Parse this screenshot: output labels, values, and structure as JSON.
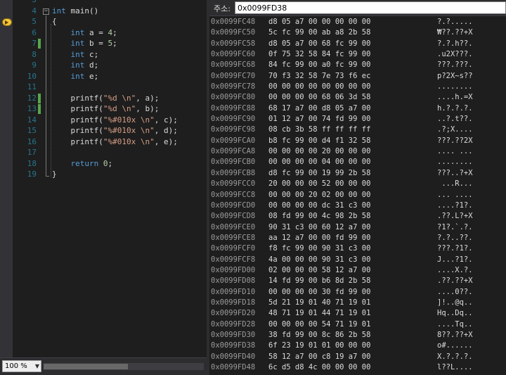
{
  "editor": {
    "lines": [
      {
        "n": "3",
        "changed": false,
        "tokens": []
      },
      {
        "n": "4",
        "changed": false,
        "tokens": [
          {
            "t": "int",
            "c": "kw"
          },
          {
            "t": " main()",
            "c": ""
          }
        ]
      },
      {
        "n": "5",
        "changed": false,
        "tokens": [
          {
            "t": "{",
            "c": ""
          }
        ]
      },
      {
        "n": "6",
        "changed": false,
        "tokens": [
          {
            "t": "    ",
            "c": ""
          },
          {
            "t": "int",
            "c": "kw"
          },
          {
            "t": " a = ",
            "c": ""
          },
          {
            "t": "4",
            "c": "num"
          },
          {
            "t": ";",
            "c": ""
          }
        ]
      },
      {
        "n": "7",
        "changed": true,
        "tokens": [
          {
            "t": "    ",
            "c": ""
          },
          {
            "t": "int",
            "c": "kw"
          },
          {
            "t": " b = ",
            "c": ""
          },
          {
            "t": "5",
            "c": "num"
          },
          {
            "t": ";",
            "c": ""
          }
        ]
      },
      {
        "n": "8",
        "changed": false,
        "tokens": [
          {
            "t": "    ",
            "c": ""
          },
          {
            "t": "int",
            "c": "kw"
          },
          {
            "t": " c;",
            "c": ""
          }
        ]
      },
      {
        "n": "9",
        "changed": false,
        "tokens": [
          {
            "t": "    ",
            "c": ""
          },
          {
            "t": "int",
            "c": "kw"
          },
          {
            "t": " d;",
            "c": ""
          }
        ]
      },
      {
        "n": "10",
        "changed": false,
        "tokens": [
          {
            "t": "    ",
            "c": ""
          },
          {
            "t": "int",
            "c": "kw"
          },
          {
            "t": " e;",
            "c": ""
          }
        ]
      },
      {
        "n": "11",
        "changed": false,
        "tokens": []
      },
      {
        "n": "12",
        "changed": true,
        "tokens": [
          {
            "t": "    printf(",
            "c": ""
          },
          {
            "t": "\"%d \\n\"",
            "c": "str"
          },
          {
            "t": ", a);",
            "c": ""
          }
        ]
      },
      {
        "n": "13",
        "changed": true,
        "tokens": [
          {
            "t": "    printf(",
            "c": ""
          },
          {
            "t": "\"%d \\n\"",
            "c": "str"
          },
          {
            "t": ", b);",
            "c": ""
          }
        ]
      },
      {
        "n": "14",
        "changed": false,
        "tokens": [
          {
            "t": "    printf(",
            "c": ""
          },
          {
            "t": "\"%#010x \\n\"",
            "c": "str"
          },
          {
            "t": ", c);",
            "c": ""
          }
        ]
      },
      {
        "n": "15",
        "changed": false,
        "tokens": [
          {
            "t": "    printf(",
            "c": ""
          },
          {
            "t": "\"%#010x \\n\"",
            "c": "str"
          },
          {
            "t": ", d);",
            "c": ""
          }
        ]
      },
      {
        "n": "16",
        "changed": false,
        "tokens": [
          {
            "t": "    printf(",
            "c": ""
          },
          {
            "t": "\"%#010x \\n\"",
            "c": "str"
          },
          {
            "t": ", e);",
            "c": ""
          }
        ]
      },
      {
        "n": "17",
        "changed": false,
        "tokens": []
      },
      {
        "n": "18",
        "changed": false,
        "tokens": [
          {
            "t": "    ",
            "c": ""
          },
          {
            "t": "return",
            "c": "kw"
          },
          {
            "t": " ",
            "c": ""
          },
          {
            "t": "0",
            "c": "num"
          },
          {
            "t": ";",
            "c": ""
          }
        ]
      },
      {
        "n": "19",
        "changed": false,
        "tokens": [
          {
            "t": "}",
            "c": ""
          }
        ]
      }
    ],
    "outline_symbol": "−",
    "zoom": "100 %"
  },
  "memory": {
    "address_label": "주소:",
    "address_value": "0x0099FD38",
    "rows": [
      {
        "addr": "0x0099FC48",
        "hex": "d8 05 a7 00 00 00 00 00",
        "ascii": "?.?....."
      },
      {
        "addr": "0x0099FC50",
        "hex": "5c fc 99 00 ab a8 2b 58",
        "ascii": "₩??.??+X"
      },
      {
        "addr": "0x0099FC58",
        "hex": "d8 05 a7 00 68 fc 99 00",
        "ascii": "?.?.h??."
      },
      {
        "addr": "0x0099FC60",
        "hex": "0f 75 32 58 84 fc 99 00",
        "ascii": ".u2X???."
      },
      {
        "addr": "0x0099FC68",
        "hex": "84 fc 99 00 a0 fc 99 00",
        "ascii": "???.???."
      },
      {
        "addr": "0x0099FC70",
        "hex": "70 f3 32 58 7e 73 f6 ec",
        "ascii": "p?2X~s??"
      },
      {
        "addr": "0x0099FC78",
        "hex": "00 00 00 00 00 00 00 00",
        "ascii": "........"
      },
      {
        "addr": "0x0099FC80",
        "hex": "00 00 00 00 68 06 3d 58",
        "ascii": "....h.=X"
      },
      {
        "addr": "0x0099FC88",
        "hex": "68 17 a7 00 d8 05 a7 00",
        "ascii": "h.?.?.?."
      },
      {
        "addr": "0x0099FC90",
        "hex": "01 12 a7 00 74 fd 99 00",
        "ascii": "..?.t??."
      },
      {
        "addr": "0x0099FC98",
        "hex": "08 cb 3b 58 ff ff ff ff",
        "ascii": ".?;X...."
      },
      {
        "addr": "0x0099FCA0",
        "hex": "b8 fc 99 00 d4 f1 32 58",
        "ascii": "???.??2X"
      },
      {
        "addr": "0x0099FCA8",
        "hex": "00 00 00 00 20 00 00 00",
        "ascii": ".... ..."
      },
      {
        "addr": "0x0099FCB0",
        "hex": "00 00 00 00 04 00 00 00",
        "ascii": "........"
      },
      {
        "addr": "0x0099FCB8",
        "hex": "d8 fc 99 00 19 99 2b 58",
        "ascii": "???..?+X"
      },
      {
        "addr": "0x0099FCC0",
        "hex": "20 00 00 00 52 00 00 00",
        "ascii": " ...R..."
      },
      {
        "addr": "0x0099FCC8",
        "hex": "00 00 00 20 02 00 00 00",
        "ascii": "... ...."
      },
      {
        "addr": "0x0099FCD0",
        "hex": "00 00 00 00 dc 31 c3 00",
        "ascii": "....?1?."
      },
      {
        "addr": "0x0099FCD8",
        "hex": "08 fd 99 00 4c 98 2b 58",
        "ascii": ".??.L?+X"
      },
      {
        "addr": "0x0099FCE0",
        "hex": "90 31 c3 00 60 12 a7 00",
        "ascii": "?1?.`.?."
      },
      {
        "addr": "0x0099FCE8",
        "hex": "aa 12 a7 00 00 fd 99 00",
        "ascii": "?.?..??."
      },
      {
        "addr": "0x0099FCF0",
        "hex": "f8 fc 99 00 90 31 c3 00",
        "ascii": "???.?1?."
      },
      {
        "addr": "0x0099FCF8",
        "hex": "4a 00 00 00 90 31 c3 00",
        "ascii": "J...?1?."
      },
      {
        "addr": "0x0099FD00",
        "hex": "02 00 00 00 58 12 a7 00",
        "ascii": "....X.?."
      },
      {
        "addr": "0x0099FD08",
        "hex": "14 fd 99 00 b6 8d 2b 58",
        "ascii": ".??.??+X"
      },
      {
        "addr": "0x0099FD10",
        "hex": "00 00 00 00 30 fd 99 00",
        "ascii": "....0??."
      },
      {
        "addr": "0x0099FD18",
        "hex": "5d 21 19 01 40 71 19 01",
        "ascii": "]!..@q.."
      },
      {
        "addr": "0x0099FD20",
        "hex": "48 71 19 01 44 71 19 01",
        "ascii": "Hq..Dq.."
      },
      {
        "addr": "0x0099FD28",
        "hex": "00 00 00 00 54 71 19 01",
        "ascii": "....Tq.."
      },
      {
        "addr": "0x0099FD30",
        "hex": "38 fd 99 00 8c 86 2b 58",
        "ascii": "8??.??+X"
      },
      {
        "addr": "0x0099FD38",
        "hex": "6f 23 19 01 01 00 00 00",
        "ascii": "o#......"
      },
      {
        "addr": "0x0099FD40",
        "hex": "58 12 a7 00 c8 19 a7 00",
        "ascii": "X.?.?.?."
      },
      {
        "addr": "0x0099FD48",
        "hex": "6c d5 d8 4c 00 00 00 00",
        "ascii": "l??L...."
      }
    ]
  },
  "colors": {
    "background": "#1e1e1e",
    "keyword": "#569cd6",
    "string": "#d69d85",
    "number": "#b5cea8",
    "line_number": "#2b91af",
    "change_marker": "#57a64a",
    "breakpoint_arrow": "#f2c73a"
  },
  "icons": {
    "current_statement": "current-statement-arrow-icon",
    "outline_toggle": "collapse-box-icon",
    "zoom_dropdown": "chevron-down-icon"
  }
}
